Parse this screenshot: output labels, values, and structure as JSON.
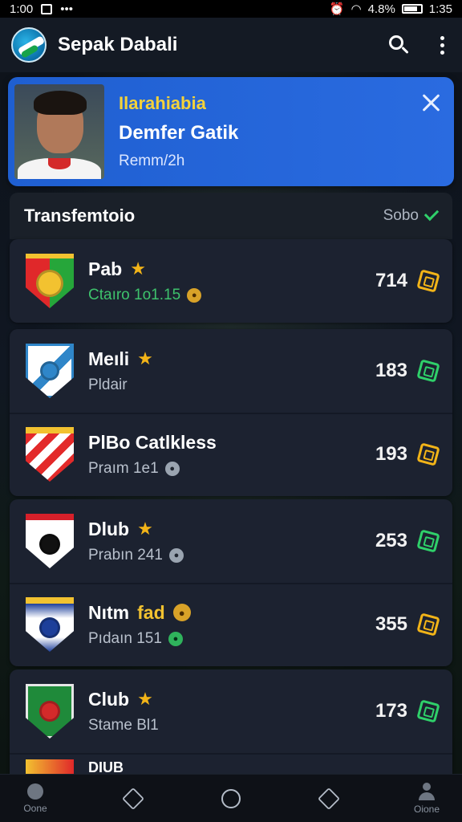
{
  "status_bar": {
    "time": "1:00",
    "dots": "•••",
    "battery": "4.8%",
    "clock": "1:35"
  },
  "app_bar": {
    "title": "Sepak Dabali",
    "icons": [
      "search-icon",
      "more-vert-icon"
    ]
  },
  "promo": {
    "kicker": "Ilarahiabia",
    "name": "Demfer Gatik",
    "meta": "Remm/2h",
    "close_icon": "close-icon"
  },
  "section": {
    "title": "Transfemtoio",
    "action": "Sobo"
  },
  "clubs": [
    {
      "name": "Pab",
      "sub": "Ctaıro 1o1.15",
      "score": "714",
      "gem": "gold"
    },
    {
      "name": "Meıli",
      "sub": "Pldair",
      "score": "183",
      "gem": "green"
    },
    {
      "name": "PlBo Catlkless",
      "sub": "Praım 1e1",
      "score": "193",
      "gem": "gold"
    },
    {
      "name": "Dlub",
      "sub": "Prabın 241",
      "score": "253",
      "gem": "green"
    },
    {
      "name": "Nıtm",
      "name_extra": "fad",
      "sub": "Pıdaın 151",
      "score": "355",
      "gem": "gold"
    },
    {
      "name": "Club",
      "sub": "Stame Bl1",
      "score": "173",
      "gem": "green"
    },
    {
      "name": "DIUB",
      "sub": "",
      "score": "",
      "gem": "none"
    }
  ],
  "nav": {
    "left_label": "Oone",
    "right_label": "Oione"
  },
  "colors": {
    "accent_blue": "#2a6be0",
    "star_gold": "#f2b418",
    "gem_green": "#2fd06a"
  }
}
